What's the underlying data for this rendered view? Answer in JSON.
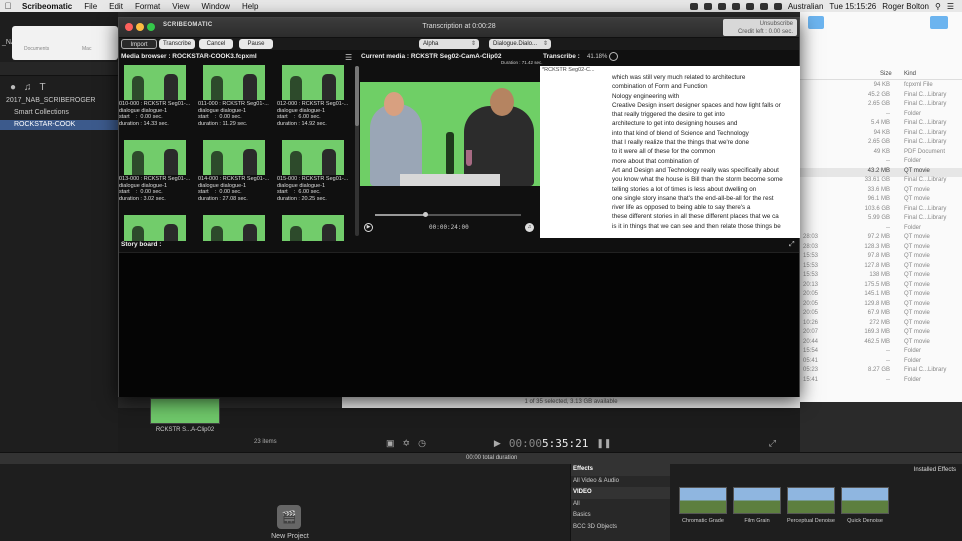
{
  "menubar": {
    "app_name": "Scribeomatic",
    "items": [
      "File",
      "Edit",
      "Format",
      "View",
      "Window",
      "Help"
    ],
    "language": "Australian",
    "clock": "Tue 15:15:26",
    "user": "Roger Bolton"
  },
  "library": {
    "title_partial": "_NA",
    "finder_labels": [
      "Documents",
      "Mac"
    ],
    "rows": [
      "2017_NAB_SCRIBEROGER",
      "Smart Collections",
      "ROCKSTAR-COOK"
    ]
  },
  "scribe": {
    "logo": "SCRIBEOMATIC",
    "title": "Transcription at 0:00:28",
    "credit_line1": "Unsubscribe",
    "credit_line2": "Credit left : 0.00 sec.",
    "toolbar": {
      "import": "Import",
      "transcribe": "Transcribe",
      "cancel": "Cancel",
      "pause": "Pause",
      "alpha": "Alpha",
      "dialogue": "Dialogue.Dialo..."
    },
    "media_browser_label": "Media browser : ROCKSTAR-COOK3.fcpxml",
    "clips": [
      {
        "name": "010-000 : RCKSTR Seg01-...",
        "sub": "dialogue dialogue-1",
        "start": "start    :  0.00 sec.",
        "duration": "duration : 14.33 sec."
      },
      {
        "name": "011-000 : RCKSTR Seg01-...",
        "sub": "dialogue dialogue-1",
        "start": "start    :  0.00 sec.",
        "duration": "duration : 11.29 sec."
      },
      {
        "name": "012-000 : RCKSTR Seg01-...",
        "sub": "dialogue dialogue-1",
        "start": "start    :  6.00 sec.",
        "duration": "duration : 14.92 sec."
      },
      {
        "name": "013-000 : RCKSTR Seg01-...",
        "sub": "dialogue dialogue-1",
        "start": "start    :  0.00 sec.",
        "duration": "duration : 3.02 sec."
      },
      {
        "name": "014-000 : RCKSTR Seg01-...",
        "sub": "dialogue dialogue-1",
        "start": "start    :  0.00 sec.",
        "duration": "duration : 27.08 sec."
      },
      {
        "name": "015-000 : RCKSTR Seg01-...",
        "sub": "dialogue dialogue-1",
        "start": "start    :  6.00 sec.",
        "duration": "duration : 20.25 sec."
      }
    ],
    "current_media_label": "Current media : RCKSTR Seg02-CamA-Clip02",
    "current_duration": "Duration : 71.42 sec.",
    "timecode": "00:00:24:00",
    "transcribe_label": "Transcribe :",
    "transcribe_pct": "41.18%",
    "transcript_clip": "*RCKSTR Seg02-C...",
    "transcript_lines": [
      "which was still very much related to architecture",
      "combination of Form and Function",
      "Nology engineering with",
      "Creative Design insert designer spaces and how light falls or",
      "that really triggered the desire to get into",
      "architecture to get into designing houses and",
      "into that kind of blend of Science and Technology",
      "that I really realize that the things that we're done",
      "to it were all of these for the common",
      "more about that combination of",
      "Art and Design and Technology really was specifically about",
      "you know what the house is Bill than the storm become some",
      "telling stories a lot of times is less about dwelling on",
      "one single story insane that's the end-all-be-all for the rest",
      "river life as opposed to being able to say there's a",
      "these different stories in all these different places that we ca",
      "is it in things that we can see and then relate those things be"
    ],
    "story_board_label": "Story board :"
  },
  "finder": {
    "col_size": "Size",
    "col_kind": "Kind",
    "rows": [
      {
        "size": "94 KB",
        "kind": "fcpxml File"
      },
      {
        "size": "45.2 GB",
        "kind": "Final C...Library"
      },
      {
        "size": "2.65 GB",
        "kind": "Final C...Library"
      },
      {
        "size": "--",
        "kind": "Folder"
      },
      {
        "size": "5.4 MB",
        "kind": "Final C...Library"
      },
      {
        "size": "94 KB",
        "kind": "Final C...Library"
      },
      {
        "size": "2.65 GB",
        "kind": "Final C...Library"
      },
      {
        "size": "49 KB",
        "kind": "PDF Document"
      },
      {
        "size": "--",
        "kind": "Folder"
      },
      {
        "size": "43.2 MB",
        "kind": "QT movie"
      },
      {
        "size": "33.61 GB",
        "kind": "Final C...Library"
      },
      {
        "size": "33.6 MB",
        "kind": "QT movie"
      },
      {
        "size": "96.1 MB",
        "kind": "QT movie"
      },
      {
        "size": "103.6 GB",
        "kind": "Final C...Library"
      },
      {
        "size": "5.99 GB",
        "kind": "Final C...Library"
      },
      {
        "size": "--",
        "kind": "Folder"
      },
      {
        "size": "97.2 MB",
        "kind": "QT movie"
      },
      {
        "size": "128.3 MB",
        "kind": "QT movie"
      },
      {
        "size": "97.8 MB",
        "kind": "QT movie"
      },
      {
        "size": "127.8 MB",
        "kind": "QT movie"
      },
      {
        "size": "138 MB",
        "kind": "QT movie"
      },
      {
        "size": "175.5 MB",
        "kind": "QT movie"
      },
      {
        "size": "145.1 MB",
        "kind": "QT movie"
      },
      {
        "size": "129.8 MB",
        "kind": "QT movie"
      },
      {
        "size": "67.9 MB",
        "kind": "QT movie"
      },
      {
        "size": "272 MB",
        "kind": "QT movie"
      },
      {
        "size": "169.3 MB",
        "kind": "QT movie"
      },
      {
        "size": "462.5 MB",
        "kind": "QT movie"
      },
      {
        "size": "--",
        "kind": "Folder"
      },
      {
        "size": "--",
        "kind": "Folder"
      },
      {
        "size": "8.27 GB",
        "kind": "Final C...Library"
      },
      {
        "size": "--",
        "kind": "Folder"
      }
    ],
    "times": [
      "",
      "",
      "",
      "",
      "",
      "",
      "",
      "",
      "",
      "",
      "",
      "",
      "",
      "",
      "",
      "",
      "28:03",
      "28:03",
      "15:53",
      "15:53",
      "15:53",
      "20:13",
      "20:05",
      "20:05",
      "20:05",
      "10:26",
      "20:07",
      "20:44",
      "15:54",
      "05:41",
      "05:23",
      "15:41"
    ],
    "status": "1 of 35 selected, 3.13 GB available"
  },
  "fcp": {
    "thumb_label": "RCKSTR S...A-Clip02",
    "items_count": "23 items",
    "timecode_dim": "00:00",
    "timecode_main": "5:35:21",
    "duration": "00:00 total duration",
    "new_project": "New Project",
    "effects_rows": [
      "Effects",
      "All Video & Audio",
      "VIDEO",
      "All",
      "Basics",
      "BCC 3D Objects"
    ],
    "installed_effects": "Installed Effects",
    "effect_thumbs": [
      "Chromatic Grade",
      "Film Grain",
      "Perceptual Denoise",
      "Quick Denoise"
    ]
  }
}
